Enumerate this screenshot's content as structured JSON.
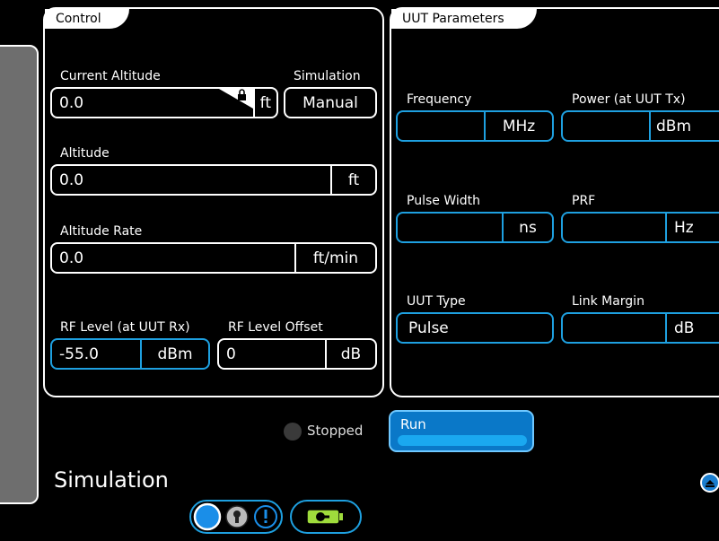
{
  "control": {
    "tab_title": "Control",
    "current_altitude": {
      "label": "Current Altitude",
      "value": "0.0",
      "unit": "ft"
    },
    "simulation": {
      "label": "Simulation",
      "value": "Manual"
    },
    "altitude": {
      "label": "Altitude",
      "value": "0.0",
      "unit": "ft"
    },
    "altitude_rate": {
      "label": "Altitude Rate",
      "value": "0.0",
      "unit": "ft/min"
    },
    "rf_level": {
      "label": "RF Level (at UUT Rx)",
      "value": "-55.0",
      "unit": "dBm"
    },
    "rf_level_offset": {
      "label": "RF Level Offset",
      "value": "0",
      "unit": "dB"
    }
  },
  "uut": {
    "tab_title": "UUT Parameters",
    "frequency": {
      "label": "Frequency",
      "value": "",
      "unit": "MHz"
    },
    "power": {
      "label": "Power (at UUT Tx)",
      "value": "",
      "unit": "dBm"
    },
    "pulse_width": {
      "label": "Pulse Width",
      "value": "",
      "unit": "ns"
    },
    "prf": {
      "label": "PRF",
      "value": "",
      "unit": "Hz"
    },
    "uut_type": {
      "label": "UUT Type",
      "value": "Pulse"
    },
    "link_margin": {
      "label": "Link Margin",
      "value": "",
      "unit": "dB"
    }
  },
  "status": {
    "text": "Stopped"
  },
  "run_button": {
    "label": "Run"
  },
  "footer": {
    "title": "Simulation"
  },
  "colors": {
    "accent": "#1ea0e0",
    "run_button": "#0a78c8",
    "side_panel": "#6e6e6e"
  },
  "icons": {
    "lock": "lock-icon",
    "scroll_top": "scroll-top-icon",
    "battery": "battery-icon"
  }
}
